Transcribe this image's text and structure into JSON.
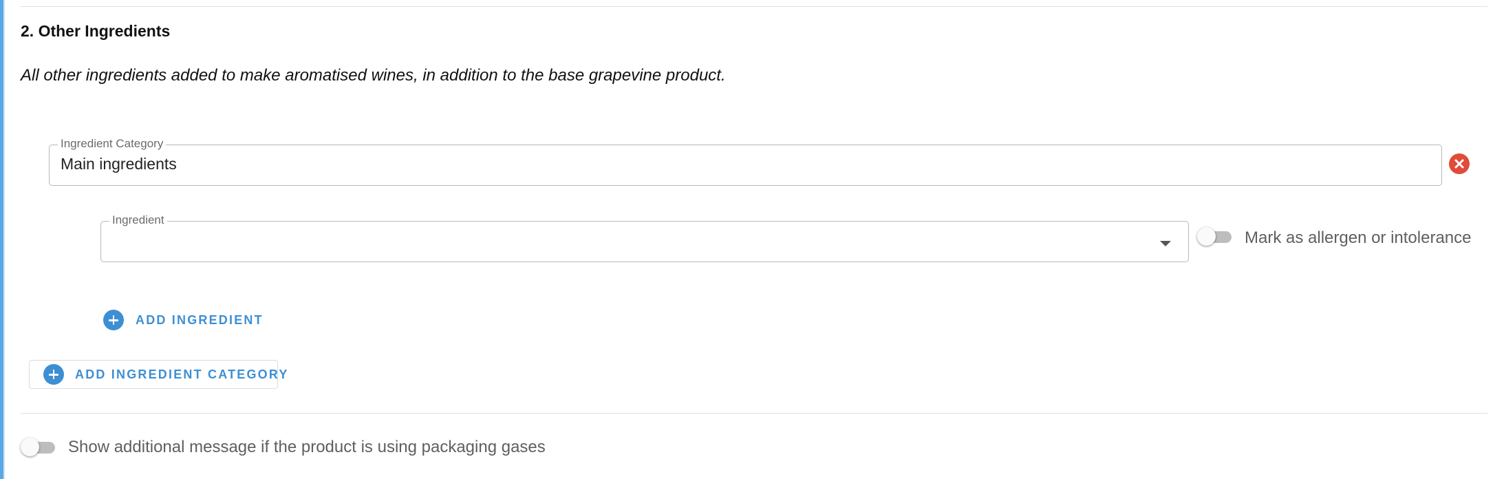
{
  "section": {
    "title": "2. Other Ingredients",
    "description": "All other ingredients added to make aromatised wines, in addition to the base grapevine product."
  },
  "ingredient_category": {
    "label": "Ingredient Category",
    "value": "Main ingredients"
  },
  "ingredient": {
    "label": "Ingredient",
    "value": "",
    "allergen_toggle_label": "Mark as allergen or intolerance",
    "allergen_toggle_on": false
  },
  "buttons": {
    "add_ingredient": "ADD INGREDIENT",
    "add_ingredient_category": "ADD INGREDIENT CATEGORY"
  },
  "packaging_gases": {
    "toggle_label": "Show additional message if the product is using packaging gases",
    "toggle_on": false
  },
  "colors": {
    "accent": "#3d8fd4",
    "remove": "#e04b3a",
    "toggle_track": "#bdbdbd"
  },
  "icons": [
    "chevron-down-icon",
    "close-circle-icon",
    "plus-circle-icon"
  ]
}
